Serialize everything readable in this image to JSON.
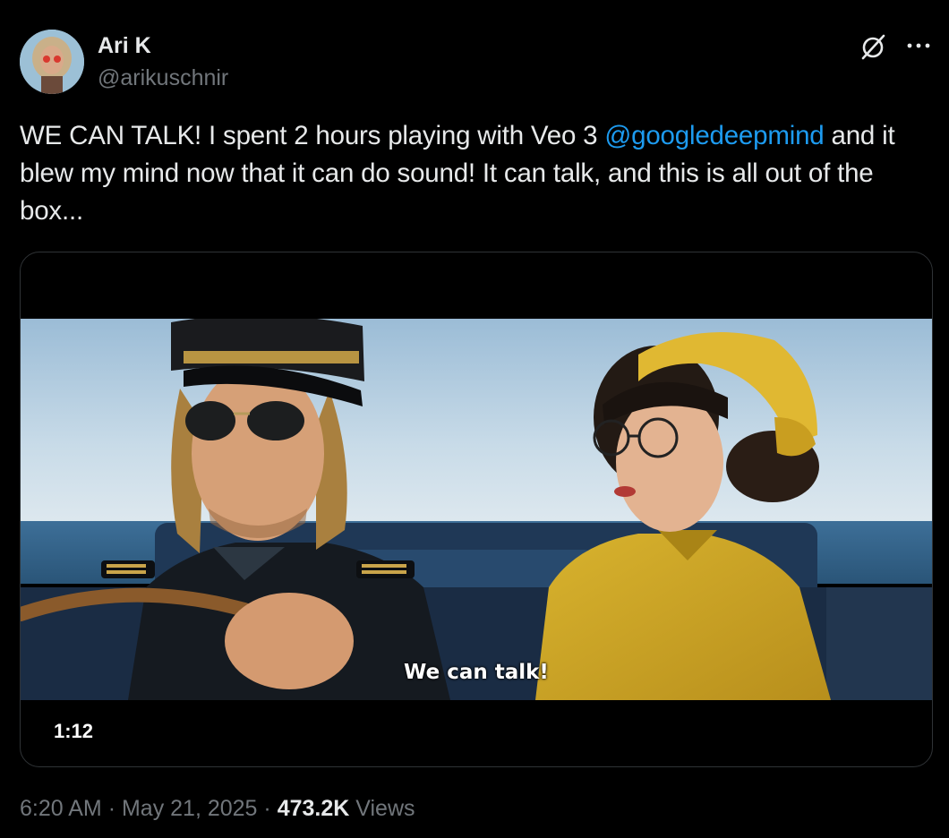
{
  "author": {
    "name": "Ari K",
    "handle": "@arikuschnir"
  },
  "tweet": {
    "text_before": "WE CAN TALK! I spent 2 hours playing with Veo 3 ",
    "mention": "@googledeepmind",
    "text_after": " and it blew my mind now that it can do sound! It can talk, and this is all out of the box..."
  },
  "media": {
    "subtitle": "We can talk!",
    "duration": "1:12"
  },
  "meta": {
    "time": "6:20 AM",
    "separator": "·",
    "date": "May 21, 2025",
    "views_count": "473.2K",
    "views_label": "Views"
  },
  "icons": {
    "grok": "grok-icon",
    "more": "more-icon"
  },
  "colors": {
    "background": "#000000",
    "text": "#e7e9ea",
    "muted": "#71767b",
    "link": "#1d9bf0",
    "border": "#2f3336"
  }
}
